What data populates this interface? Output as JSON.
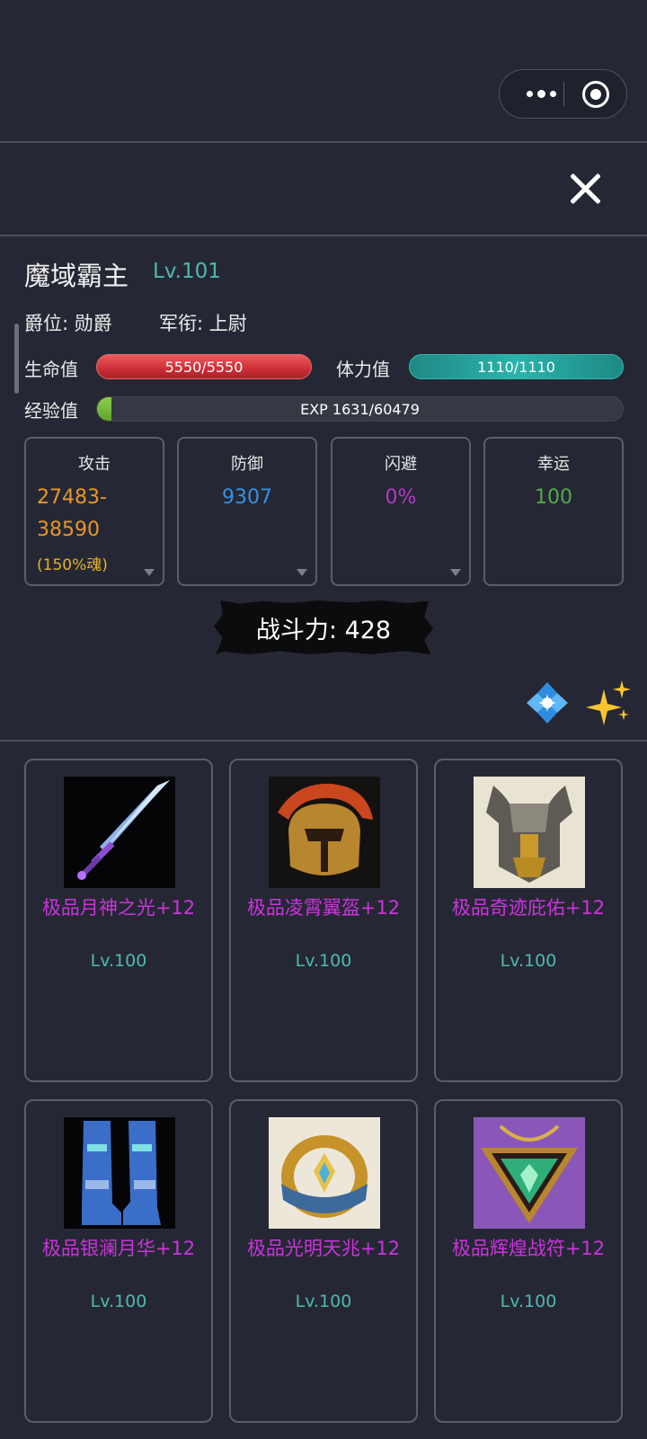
{
  "header": {
    "menu_icon": "more-dots-icon",
    "close_capsule_icon": "target-circle-icon",
    "close_icon": "close-x-icon"
  },
  "character": {
    "name": "魔域霸主",
    "level": "Lv.101",
    "title_label": "爵位: 勋爵",
    "rank_label": "军衔: 上尉"
  },
  "bars": {
    "hp_label": "生命值",
    "hp_value": "5550/5550",
    "hp_fraction": 1.0,
    "stamina_label": "体力值",
    "stamina_value": "1110/1110",
    "stamina_fraction": 1.0,
    "exp_label": "经验值",
    "exp_value": "EXP 1631/60479",
    "exp_fraction": 0.027
  },
  "stats": [
    {
      "title": "攻击",
      "value": "27483-38590",
      "extra": "(150%魂)",
      "color": "#e8962a",
      "expandable": true
    },
    {
      "title": "防御",
      "value": "9307",
      "color": "#3a8fe0",
      "expandable": true
    },
    {
      "title": "闪避",
      "value": "0%",
      "color": "#b238c8",
      "expandable": true
    },
    {
      "title": "幸运",
      "value": "100",
      "color": "#55a84a",
      "expandable": false
    }
  ],
  "power": {
    "text": "战斗力: 428"
  },
  "effect_icons": [
    "blue-gem-sparkle-icon",
    "sparkles-icon"
  ],
  "equipment": [
    {
      "name": "极品月神之光+12",
      "level": "Lv.100",
      "icon": "sword-icon"
    },
    {
      "name": "极品凌霄翼盔+12",
      "level": "Lv.100",
      "icon": "helmet-icon"
    },
    {
      "name": "极品奇迹庇佑+12",
      "level": "Lv.100",
      "icon": "armor-icon"
    },
    {
      "name": "极品银澜月华+12",
      "level": "Lv.100",
      "icon": "boots-icon"
    },
    {
      "name": "极品光明天兆+12",
      "level": "Lv.100",
      "icon": "ring-icon"
    },
    {
      "name": "极品辉煌战符+12",
      "level": "Lv.100",
      "icon": "amulet-icon"
    }
  ],
  "colors": {
    "background": "#252834",
    "item_name": "#cc33dd",
    "level_teal": "#4fb9b0"
  }
}
